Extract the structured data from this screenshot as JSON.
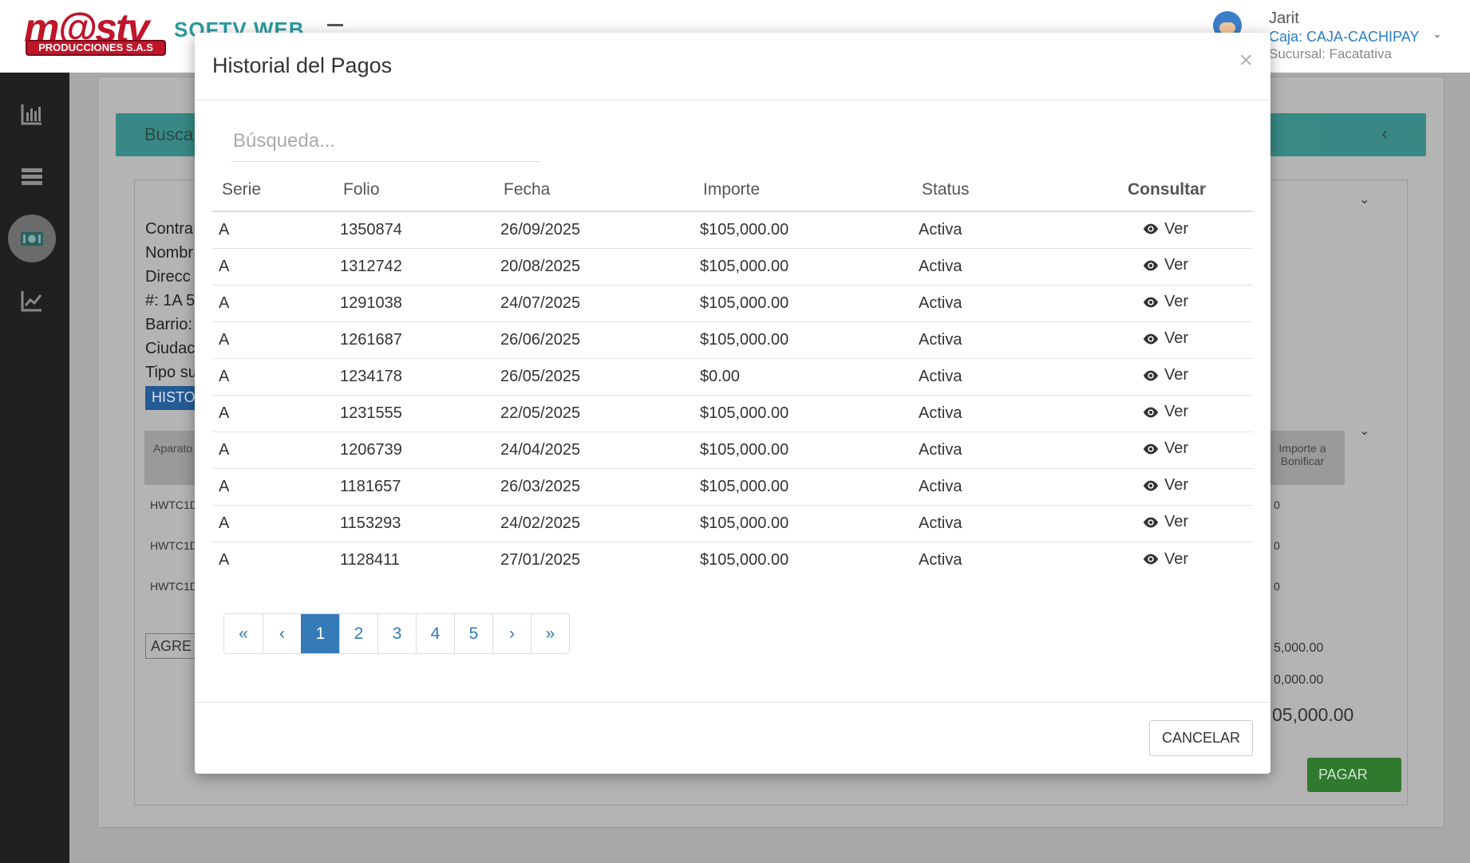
{
  "app": {
    "logo_text": "m@stv",
    "logo_subtitle": "PRODUCCIONES S.A.S",
    "name": "SOFTV WEB"
  },
  "user": {
    "name": "Jarit",
    "caja": "Caja: CAJA-CACHIPAY",
    "sucursal": "Sucursal: Facatativa"
  },
  "background": {
    "search_header": "Busca",
    "fields": [
      "Contra",
      "Nombr",
      "Direcc",
      "#: 1A 5",
      "Barrio:",
      "Ciudac",
      "Tipo su"
    ],
    "history_button": "HISTO",
    "table_header_col": "Aparato",
    "table_header_right": "Importe a Bonificar",
    "rows": [
      "HWTC1D",
      "HWTC1D",
      "HWTC1D"
    ],
    "row_values": [
      "0",
      "0",
      "0"
    ],
    "agregar_button": "AGRE",
    "totals": [
      "5,000.00",
      "0,000.00"
    ],
    "grand_total": "05,000.00",
    "pay_button": "PAGAR"
  },
  "modal": {
    "title": "Historial del Pagos",
    "close_symbol": "×",
    "search_placeholder": "Búsqueda...",
    "columns": [
      "Serie",
      "Folio",
      "Fecha",
      "Importe",
      "Status",
      "Consultar"
    ],
    "rows": [
      {
        "serie": "A",
        "folio": "1350874",
        "fecha": "26/09/2025",
        "importe": "$105,000.00",
        "status": "Activa",
        "action": "Ver"
      },
      {
        "serie": "A",
        "folio": "1312742",
        "fecha": "20/08/2025",
        "importe": "$105,000.00",
        "status": "Activa",
        "action": "Ver"
      },
      {
        "serie": "A",
        "folio": "1291038",
        "fecha": "24/07/2025",
        "importe": "$105,000.00",
        "status": "Activa",
        "action": "Ver"
      },
      {
        "serie": "A",
        "folio": "1261687",
        "fecha": "26/06/2025",
        "importe": "$105,000.00",
        "status": "Activa",
        "action": "Ver"
      },
      {
        "serie": "A",
        "folio": "1234178",
        "fecha": "26/05/2025",
        "importe": "$0.00",
        "status": "Activa",
        "action": "Ver"
      },
      {
        "serie": "A",
        "folio": "1231555",
        "fecha": "22/05/2025",
        "importe": "$105,000.00",
        "status": "Activa",
        "action": "Ver"
      },
      {
        "serie": "A",
        "folio": "1206739",
        "fecha": "24/04/2025",
        "importe": "$105,000.00",
        "status": "Activa",
        "action": "Ver"
      },
      {
        "serie": "A",
        "folio": "1181657",
        "fecha": "26/03/2025",
        "importe": "$105,000.00",
        "status": "Activa",
        "action": "Ver"
      },
      {
        "serie": "A",
        "folio": "1153293",
        "fecha": "24/02/2025",
        "importe": "$105,000.00",
        "status": "Activa",
        "action": "Ver"
      },
      {
        "serie": "A",
        "folio": "1128411",
        "fecha": "27/01/2025",
        "importe": "$105,000.00",
        "status": "Activa",
        "action": "Ver"
      }
    ],
    "pagination": {
      "first": "«",
      "prev": "‹",
      "pages": [
        "1",
        "2",
        "3",
        "4",
        "5"
      ],
      "current": "1",
      "next": "›",
      "last": "»"
    },
    "cancel_label": "CANCELAR"
  },
  "colors": {
    "accent": "#337ab7",
    "sidebar": "#202020",
    "brand_red": "#c0152a",
    "teal": "#2a9aa0",
    "pay_green": "#2f7a2f"
  },
  "icons": [
    "bar-chart-icon",
    "list-icon",
    "money-icon",
    "trend-icon",
    "eye-icon",
    "chevron-down-icon",
    "chevron-left-icon",
    "close-icon"
  ]
}
